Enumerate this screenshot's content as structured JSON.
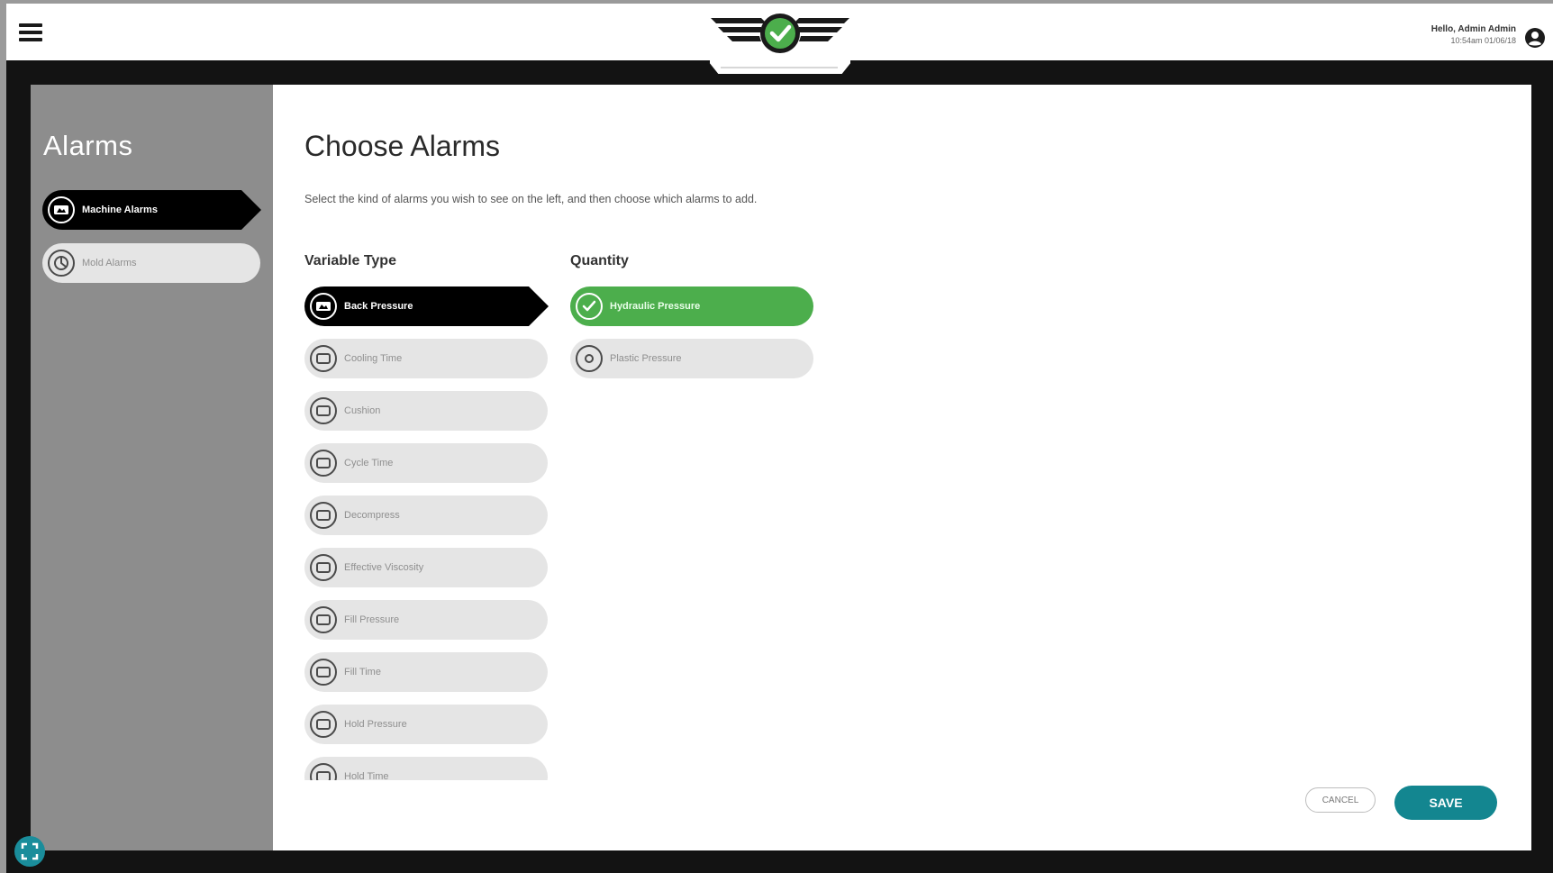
{
  "header": {
    "greeting": "Hello, Admin Admin",
    "timestamp": "10:54am 01/06/18"
  },
  "sidebar": {
    "title": "Alarms",
    "items": [
      {
        "label": "Machine Alarms",
        "icon": "machine-icon",
        "state": "active"
      },
      {
        "label": "Mold Alarms",
        "icon": "mold-icon",
        "state": "inactive"
      }
    ]
  },
  "main": {
    "title": "Choose Alarms",
    "description": "Select the kind of alarms you wish to see on the left, and then choose which alarms to add.",
    "variable_type_heading": "Variable Type",
    "quantity_heading": "Quantity",
    "variable_types": [
      {
        "label": "Back Pressure",
        "state": "active"
      },
      {
        "label": "Cooling Time",
        "state": "inactive"
      },
      {
        "label": "Cushion",
        "state": "inactive"
      },
      {
        "label": "Cycle Time",
        "state": "inactive"
      },
      {
        "label": "Decompress",
        "state": "inactive"
      },
      {
        "label": "Effective Viscosity",
        "state": "inactive"
      },
      {
        "label": "Fill Pressure",
        "state": "inactive"
      },
      {
        "label": "Fill Time",
        "state": "inactive"
      },
      {
        "label": "Hold Pressure",
        "state": "inactive"
      },
      {
        "label": "Hold Time",
        "state": "inactive"
      }
    ],
    "quantities": [
      {
        "label": "Hydraulic Pressure",
        "selected": true
      },
      {
        "label": "Plastic Pressure",
        "selected": false
      }
    ],
    "cancel_label": "CANCEL",
    "save_label": "SAVE"
  },
  "colors": {
    "accent_teal": "#138690",
    "selected_green": "#4cae4c",
    "sidebar_grey": "#8d8d8d"
  }
}
